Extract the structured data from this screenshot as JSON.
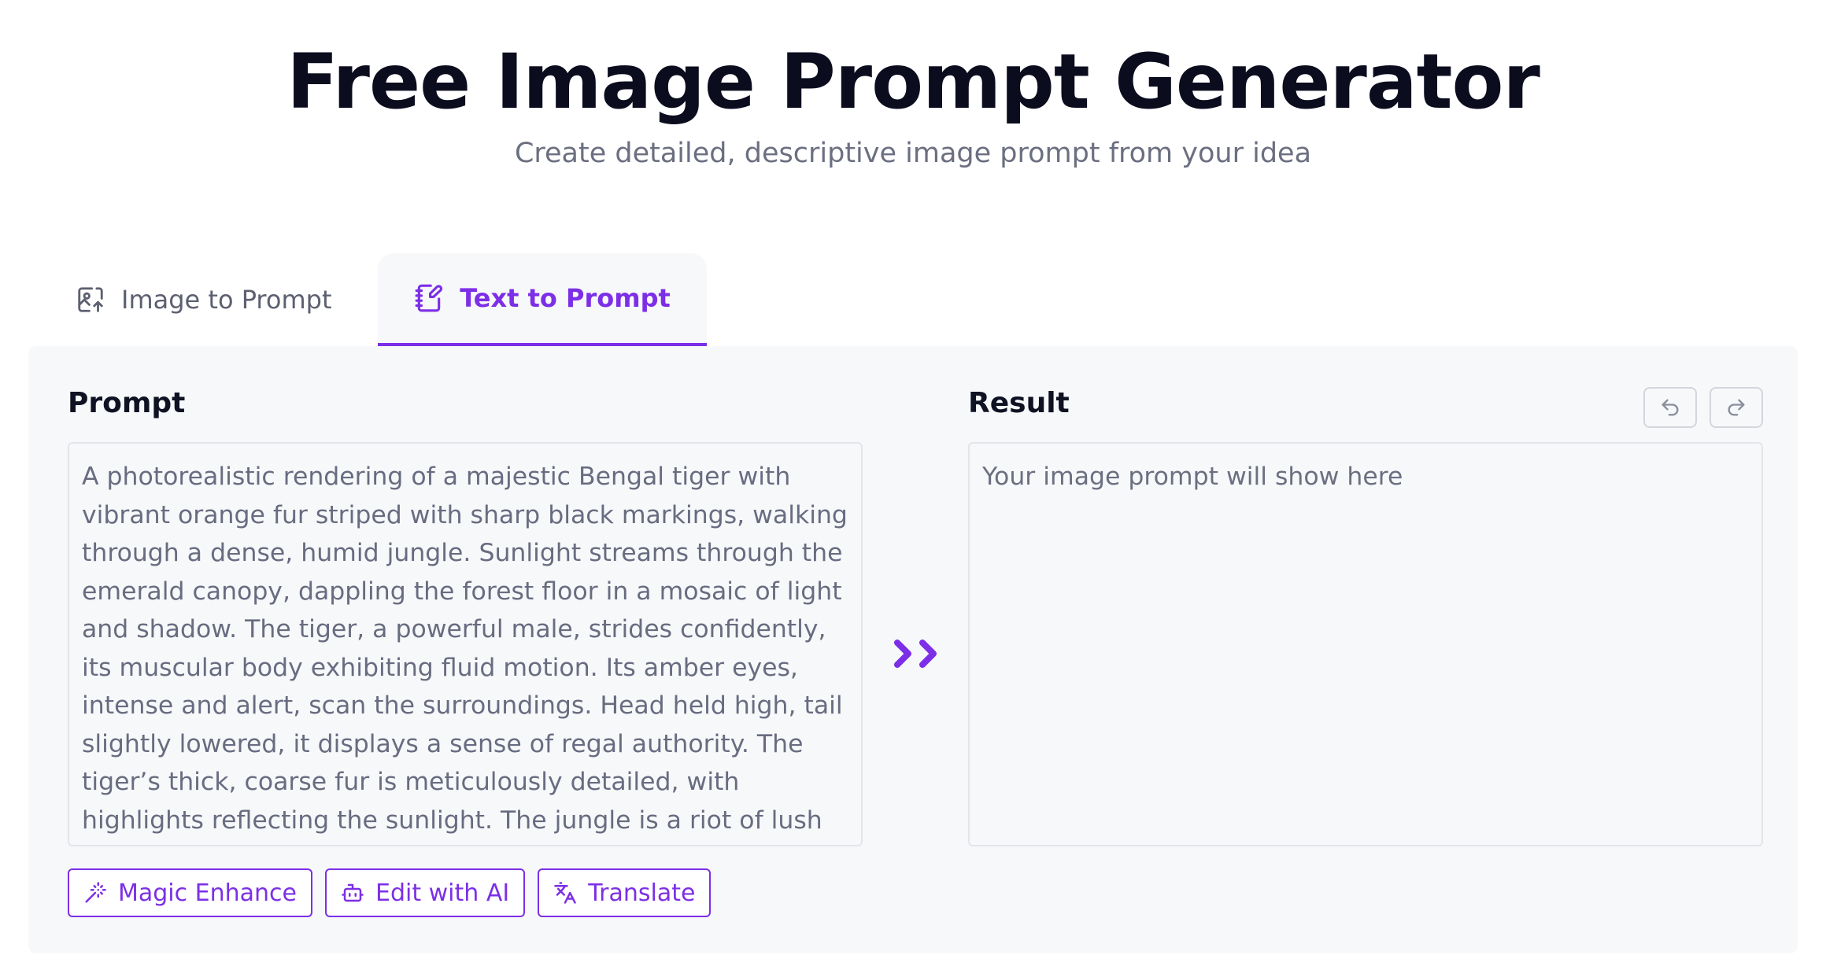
{
  "header": {
    "title": "Free Image Prompt Generator",
    "subtitle": "Create detailed, descriptive image prompt from your idea"
  },
  "tabs": [
    {
      "label": "Image to Prompt",
      "icon": "image-upload-icon",
      "active": false
    },
    {
      "label": "Text to Prompt",
      "icon": "notebook-pen-icon",
      "active": true
    }
  ],
  "prompt": {
    "label": "Prompt",
    "value": "A photorealistic rendering of a majestic Bengal tiger with vibrant orange fur striped with sharp black markings, walking through a dense, humid jungle. Sunlight streams through the emerald canopy, dappling the forest floor in a mosaic of light and shadow. The tiger, a powerful male, strides confidently, its muscular body exhibiting fluid motion. Its amber eyes, intense and alert, scan the surroundings.  Head held high, tail slightly lowered, it displays a sense of regal authority.  The tiger’s thick, coarse fur is meticulously detailed, with highlights reflecting the sunlight. The jungle is a riot of lush green foliage—ferns, broad-leafed plants,"
  },
  "result": {
    "label": "Result",
    "placeholder": "Your image prompt will show here"
  },
  "history": {
    "undo_icon": "undo-icon",
    "redo_icon": "redo-icon"
  },
  "actions": [
    {
      "label": "Magic Enhance",
      "icon": "magic-wand-icon"
    },
    {
      "label": "Edit with AI",
      "icon": "robot-icon"
    },
    {
      "label": "Translate",
      "icon": "translate-icon"
    }
  ],
  "colors": {
    "accent": "#7c2fe6",
    "panel_bg": "#f7f8fa",
    "title": "#0b0d1e",
    "muted_text": "#6b6f80"
  }
}
